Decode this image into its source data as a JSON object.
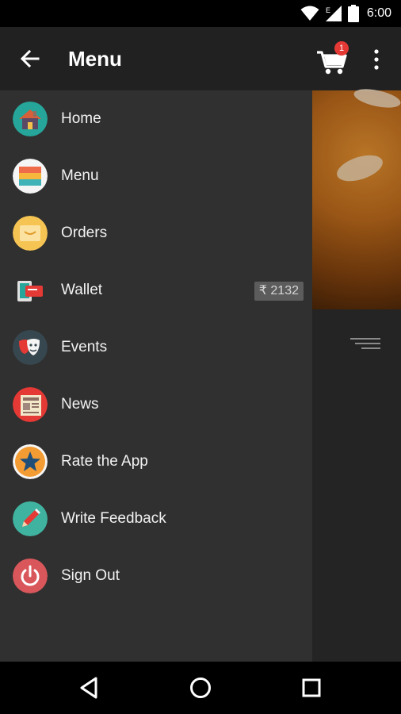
{
  "status_bar": {
    "time": "6:00",
    "network_label": "E",
    "icons": [
      "wifi-icon",
      "signal-icon",
      "battery-icon"
    ]
  },
  "toolbar": {
    "title": "Menu",
    "cart_count": "1",
    "icons": [
      "back-arrow-icon",
      "cart-icon",
      "overflow-menu-icon"
    ]
  },
  "drawer": {
    "items": [
      {
        "label": "Home",
        "icon": "home-icon"
      },
      {
        "label": "Menu",
        "icon": "menu-stack-icon"
      },
      {
        "label": "Orders",
        "icon": "orders-box-icon"
      },
      {
        "label": "Wallet",
        "icon": "wallet-icon",
        "badge": "₹ 2132"
      },
      {
        "label": "Events",
        "icon": "theater-masks-icon"
      },
      {
        "label": "News",
        "icon": "newspaper-icon"
      },
      {
        "label": "Rate the App",
        "icon": "star-icon"
      },
      {
        "label": "Write Feedback",
        "icon": "pencil-icon"
      },
      {
        "label": "Sign Out",
        "icon": "power-icon"
      }
    ]
  },
  "nav_bar": {
    "icons": [
      "back-triangle-icon",
      "home-circle-icon",
      "recents-square-icon"
    ]
  },
  "colors": {
    "drawer_bg": "#303030",
    "toolbar_bg": "#212121",
    "badge_red": "#e53935"
  }
}
